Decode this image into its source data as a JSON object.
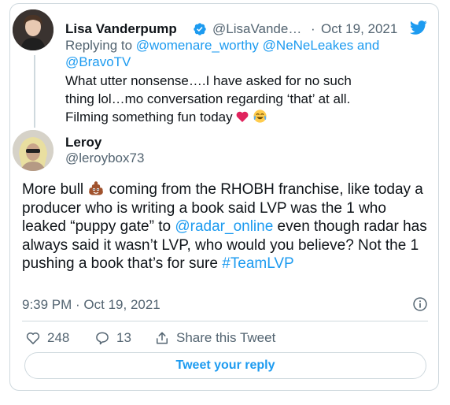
{
  "quoted": {
    "name": "Lisa Vanderpump",
    "handle": "@LisaVande…",
    "date": "Oct 19, 2021",
    "replying_to_prefix": "Replying to ",
    "reply_handles_line1": "@womenare_worthy @NeNeLeakes and",
    "reply_handles_line2": "@BravoTV",
    "text_line1": "What utter nonsense….I have asked for no such",
    "text_line2": "thing lol…mo conversation regarding ‘that’ at all.",
    "text_line3": "Filming something fun today"
  },
  "tweet": {
    "name": "Leroy",
    "handle": "@leroybox73",
    "text_part1": "More bull",
    "text_part2": " coming from the RHOBH franchise, like today a producer who is writing a book said LVP was the 1 who leaked “puppy gate” to ",
    "mention": "@radar_online",
    "text_part3": " even though radar has always said it wasn’t LVP, who would you believe? Not the 1 pushing a book that’s for sure ",
    "hashtag": "#TeamLVP",
    "timestamp": "9:39 PM · Oct 19, 2021"
  },
  "actions": {
    "likes": "248",
    "replies": "13",
    "share_label": "Share this Tweet"
  },
  "reply_button_label": "Tweet your reply",
  "colors": {
    "accent": "#1d9bf0",
    "like_heart": "#f91880",
    "text_primary": "#0f1419",
    "text_secondary": "#536471",
    "border": "#cfd9de"
  },
  "icons": [
    "verified-badge-icon",
    "twitter-bird-icon",
    "info-icon",
    "heart-icon",
    "reply-bubble-icon",
    "share-icon",
    "red-heart-emoji",
    "tears-of-joy-emoji",
    "pile-of-poo-emoji"
  ]
}
